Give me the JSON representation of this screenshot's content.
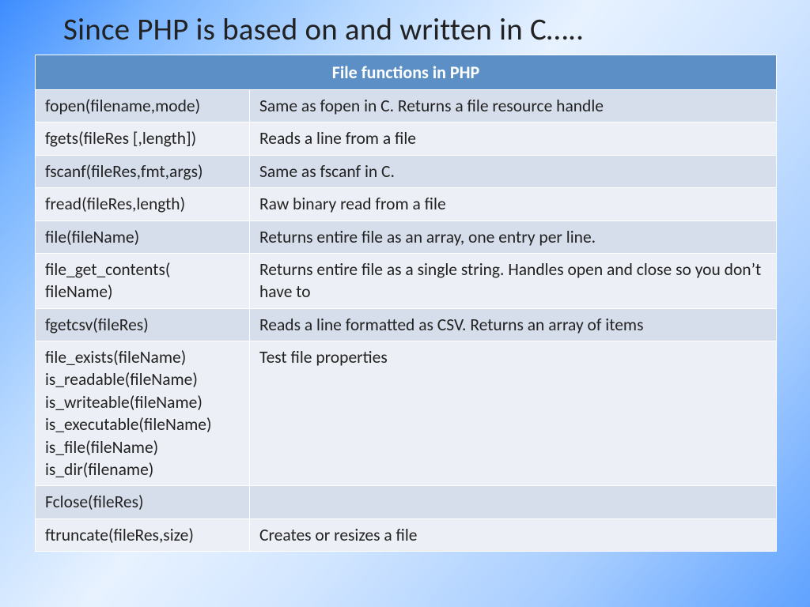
{
  "title": "Since PHP is based on and written in C…..",
  "table": {
    "header": "File functions in PHP",
    "rows": [
      {
        "func": "fopen(filename,mode)",
        "desc": "Same as fopen in C.  Returns a file resource handle"
      },
      {
        "func": "fgets(fileRes [,length])",
        "desc": "Reads a line from a file"
      },
      {
        "func": "fscanf(fileRes,fmt,args)",
        "desc": "Same as fscanf in C."
      },
      {
        "func": "fread(fileRes,length)",
        "desc": "Raw binary read from a file"
      },
      {
        "func": "file(fileName)",
        "desc": "Returns entire file as an array, one entry per line."
      },
      {
        "func": "file_get_contents(\n                        fileName)",
        "desc": "Returns entire file as a single string.  Handles open and close so you don’t have to"
      },
      {
        "func": "fgetcsv(fileRes)",
        "desc": "Reads a line formatted as CSV.  Returns an array of items"
      },
      {
        "func": "file_exists(fileName)\nis_readable(fileName)\nis_writeable(fileName)\nis_executable(fileName)\nis_file(fileName)\nis_dir(filename)",
        "desc": "Test file properties"
      },
      {
        "func": "Fclose(fileRes)",
        "desc": ""
      },
      {
        "func": "ftruncate(fileRes,size)",
        "desc": "Creates or resizes a file"
      }
    ]
  }
}
